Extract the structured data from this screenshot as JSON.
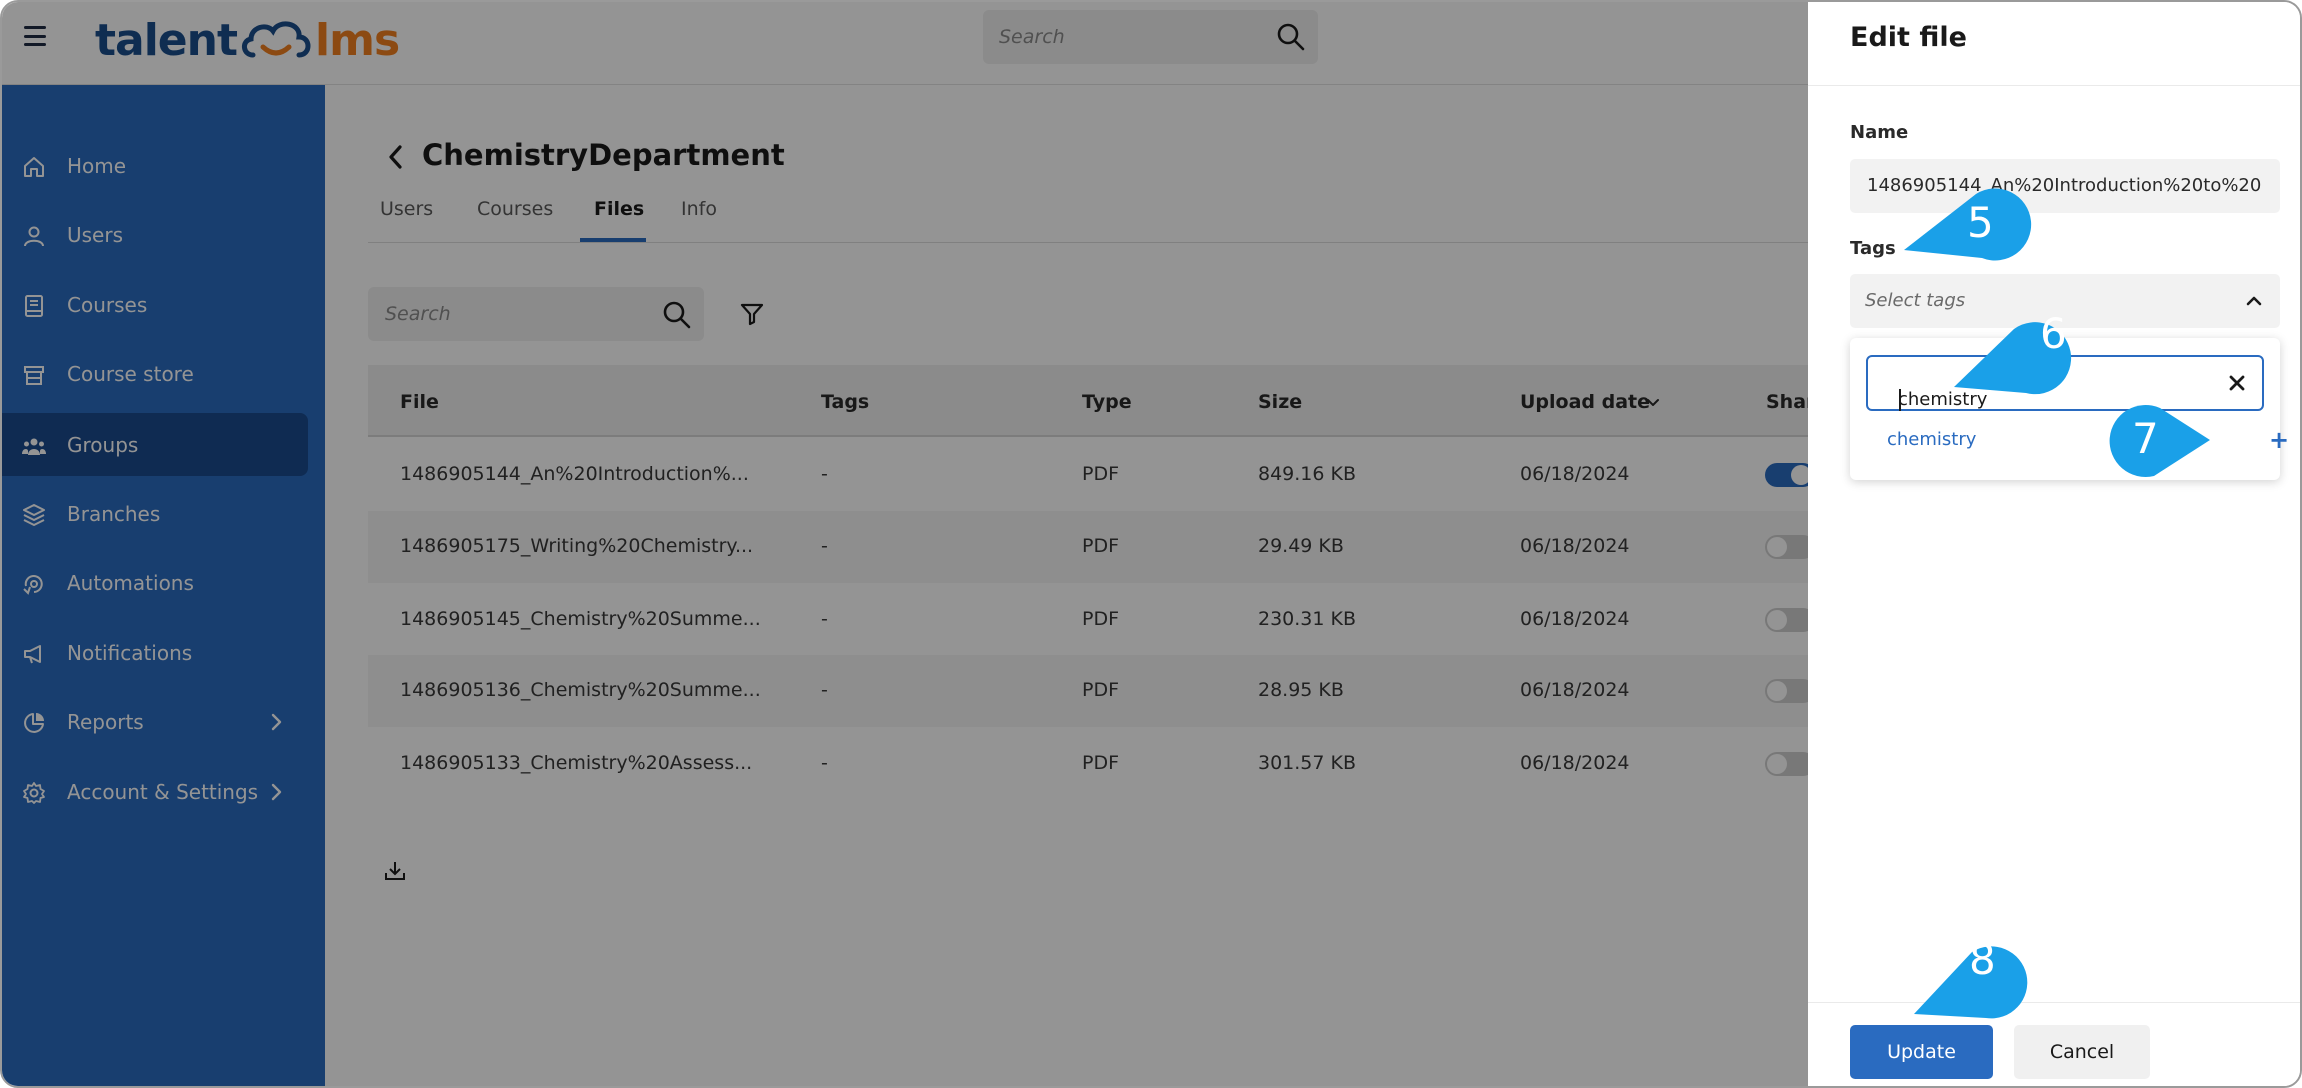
{
  "header": {
    "logo_left": "talent",
    "logo_right": "lms",
    "search_placeholder": "Search"
  },
  "sidebar": {
    "items": [
      {
        "label": "Home",
        "icon": "home-icon"
      },
      {
        "label": "Users",
        "icon": "user-icon"
      },
      {
        "label": "Courses",
        "icon": "book-icon"
      },
      {
        "label": "Course store",
        "icon": "store-icon"
      },
      {
        "label": "Groups",
        "icon": "groups-icon",
        "active": true
      },
      {
        "label": "Branches",
        "icon": "layers-icon"
      },
      {
        "label": "Automations",
        "icon": "automation-icon"
      },
      {
        "label": "Notifications",
        "icon": "megaphone-icon"
      },
      {
        "label": "Reports",
        "icon": "pie-chart-icon",
        "has_submenu": true
      },
      {
        "label": "Account & Settings",
        "icon": "gear-icon",
        "has_submenu": true
      }
    ]
  },
  "main": {
    "title": "ChemistryDepartment",
    "tabs": [
      "Users",
      "Courses",
      "Files",
      "Info"
    ],
    "active_tab": "Files",
    "search_placeholder": "Search",
    "table": {
      "headers": [
        "File",
        "Tags",
        "Type",
        "Size",
        "Upload date",
        "Shar"
      ],
      "rows": [
        {
          "file": "1486905144_An%20Introduction%...",
          "tags": "-",
          "type": "PDF",
          "size": "849.16 KB",
          "date": "06/18/2024",
          "shared": true
        },
        {
          "file": "1486905175_Writing%20Chemistry...",
          "tags": "-",
          "type": "PDF",
          "size": "29.49 KB",
          "date": "06/18/2024",
          "shared": false
        },
        {
          "file": "1486905145_Chemistry%20Summe...",
          "tags": "-",
          "type": "PDF",
          "size": "230.31 KB",
          "date": "06/18/2024",
          "shared": false
        },
        {
          "file": "1486905136_Chemistry%20Summe...",
          "tags": "-",
          "type": "PDF",
          "size": "28.95 KB",
          "date": "06/18/2024",
          "shared": false
        },
        {
          "file": "1486905133_Chemistry%20Assess...",
          "tags": "-",
          "type": "PDF",
          "size": "301.57 KB",
          "date": "06/18/2024",
          "shared": false
        }
      ]
    }
  },
  "panel": {
    "title": "Edit file",
    "name_label": "Name",
    "name_value": "1486905144_An%20Introduction%20to%20",
    "tags_label": "Tags",
    "tags_placeholder": "Select tags",
    "tag_search_value": "chemistry",
    "tag_option": "chemistry",
    "tag_add_symbol": "+",
    "update_label": "Update",
    "cancel_label": "Cancel"
  },
  "callouts": {
    "step5": "5",
    "step6": "6",
    "step7": "7",
    "step8": "8"
  },
  "colors": {
    "sidebar_bg": "#2a6bc0",
    "sidebar_active": "#1b4a8d",
    "accent": "#2a6bc0",
    "callout": "#1aa0e8",
    "logo_blue": "#1b4f8c",
    "logo_orange": "#f1801f"
  }
}
